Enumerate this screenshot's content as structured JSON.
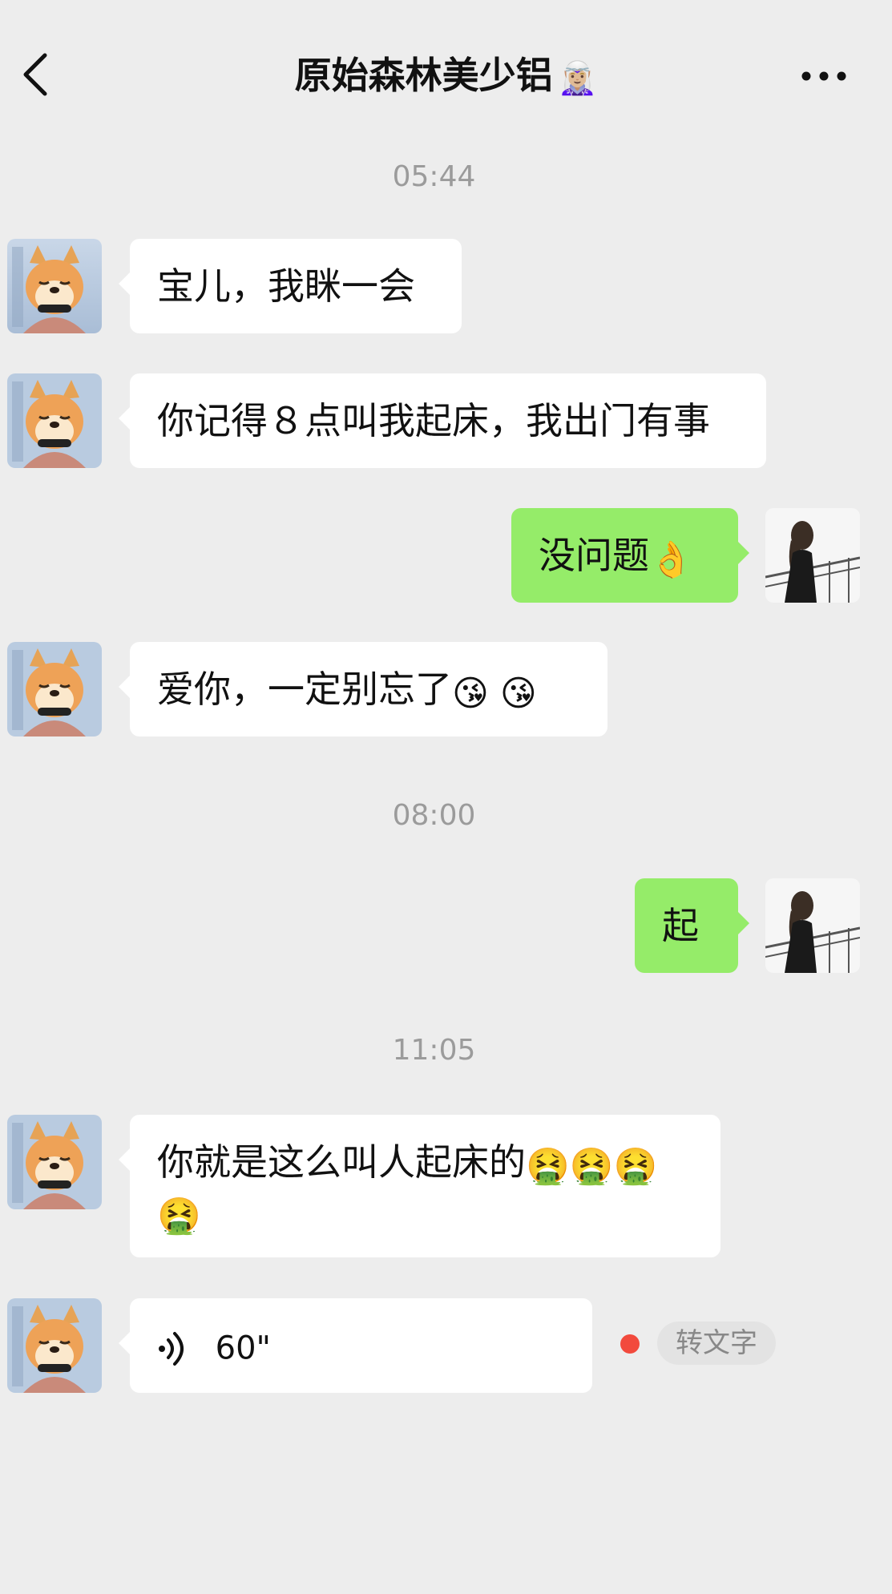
{
  "header": {
    "title": "原始森林美少铝",
    "title_emoji": "🧝🏼‍♀️",
    "back_icon": "chevron-left-icon",
    "more_icon": "more-dots-icon"
  },
  "timestamps": [
    "05:44",
    "08:00",
    "11:05"
  ],
  "messages": [
    {
      "side": "in",
      "text": "宝儿，我眯一会"
    },
    {
      "side": "in",
      "text": "你记得８点叫我起床，我出门有事"
    },
    {
      "side": "out",
      "text": "没问题",
      "emoji": "👌"
    },
    {
      "side": "in",
      "text": "爱你，一定别忘了",
      "emoji": "😘 😘"
    },
    {
      "side": "out",
      "text": "起"
    },
    {
      "side": "in",
      "text": "你就是这么叫人起床的",
      "emoji": "🤮🤮🤮",
      "emoji2": "🤮"
    },
    {
      "side": "in",
      "type": "voice",
      "duration": "60\""
    }
  ],
  "voice": {
    "to_text_label": "转文字",
    "unread_color": "#f24a3d"
  },
  "colors": {
    "background": "#ededed",
    "incoming_bubble": "#ffffff",
    "outgoing_bubble": "#95ec69",
    "timestamp": "#9b9b9b"
  }
}
